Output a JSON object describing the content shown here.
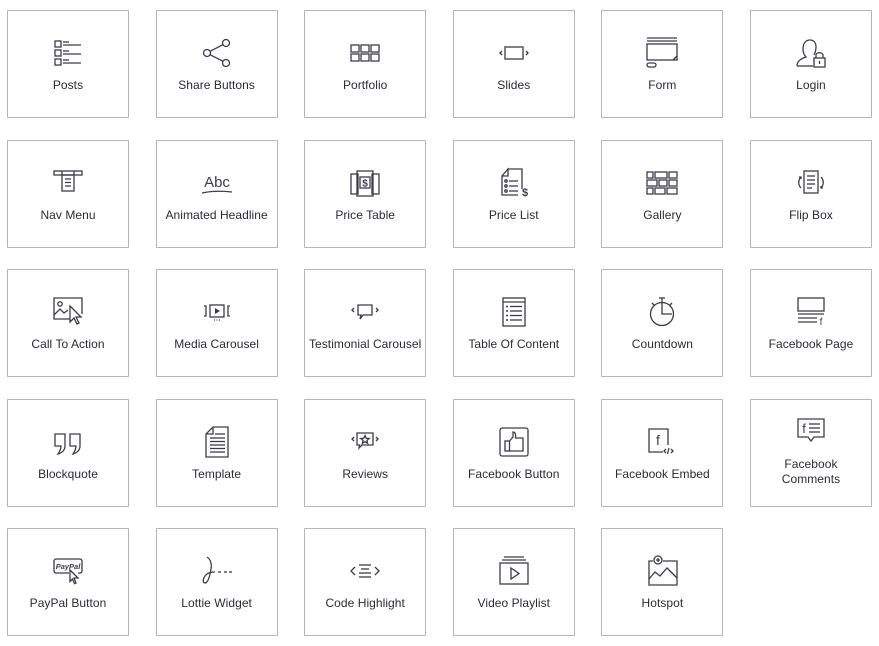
{
  "widgets": [
    {
      "label": "Posts",
      "icon": "posts-icon"
    },
    {
      "label": "Share Buttons",
      "icon": "share-icon"
    },
    {
      "label": "Portfolio",
      "icon": "portfolio-grid-icon"
    },
    {
      "label": "Slides",
      "icon": "slides-icon"
    },
    {
      "label": "Form",
      "icon": "form-icon"
    },
    {
      "label": "Login",
      "icon": "login-user-lock-icon"
    },
    {
      "label": "Nav Menu",
      "icon": "nav-menu-icon"
    },
    {
      "label": "Animated Headline",
      "icon": "animated-headline-icon"
    },
    {
      "label": "Price Table",
      "icon": "price-table-icon"
    },
    {
      "label": "Price List",
      "icon": "price-list-icon"
    },
    {
      "label": "Gallery",
      "icon": "gallery-icon"
    },
    {
      "label": "Flip Box",
      "icon": "flip-box-icon"
    },
    {
      "label": "Call To Action",
      "icon": "call-to-action-icon"
    },
    {
      "label": "Media Carousel",
      "icon": "media-carousel-icon"
    },
    {
      "label": "Testimonial Carousel",
      "icon": "testimonial-carousel-icon"
    },
    {
      "label": "Table Of Content",
      "icon": "table-of-content-icon"
    },
    {
      "label": "Countdown",
      "icon": "countdown-stopwatch-icon"
    },
    {
      "label": "Facebook Page",
      "icon": "facebook-page-icon"
    },
    {
      "label": "Blockquote",
      "icon": "blockquote-icon"
    },
    {
      "label": "Template",
      "icon": "template-document-icon"
    },
    {
      "label": "Reviews",
      "icon": "reviews-star-icon"
    },
    {
      "label": "Facebook Button",
      "icon": "facebook-like-button-icon"
    },
    {
      "label": "Facebook Embed",
      "icon": "facebook-embed-icon"
    },
    {
      "label": "Facebook Comments",
      "icon": "facebook-comments-icon"
    },
    {
      "label": "PayPal Button",
      "icon": "paypal-button-icon"
    },
    {
      "label": "Lottie Widget",
      "icon": "lottie-icon"
    },
    {
      "label": "Code Highlight",
      "icon": "code-highlight-icon"
    },
    {
      "label": "Video Playlist",
      "icon": "video-playlist-icon"
    },
    {
      "label": "Hotspot",
      "icon": "hotspot-icon"
    }
  ],
  "icon_text": {
    "animated_headline": "Abc",
    "price_symbol": "$",
    "paypal": "PayPal",
    "facebook_f": "f"
  },
  "colors": {
    "icon": "#3c3a4f",
    "border": "#b5b5b5",
    "text": "#2b2b33"
  }
}
